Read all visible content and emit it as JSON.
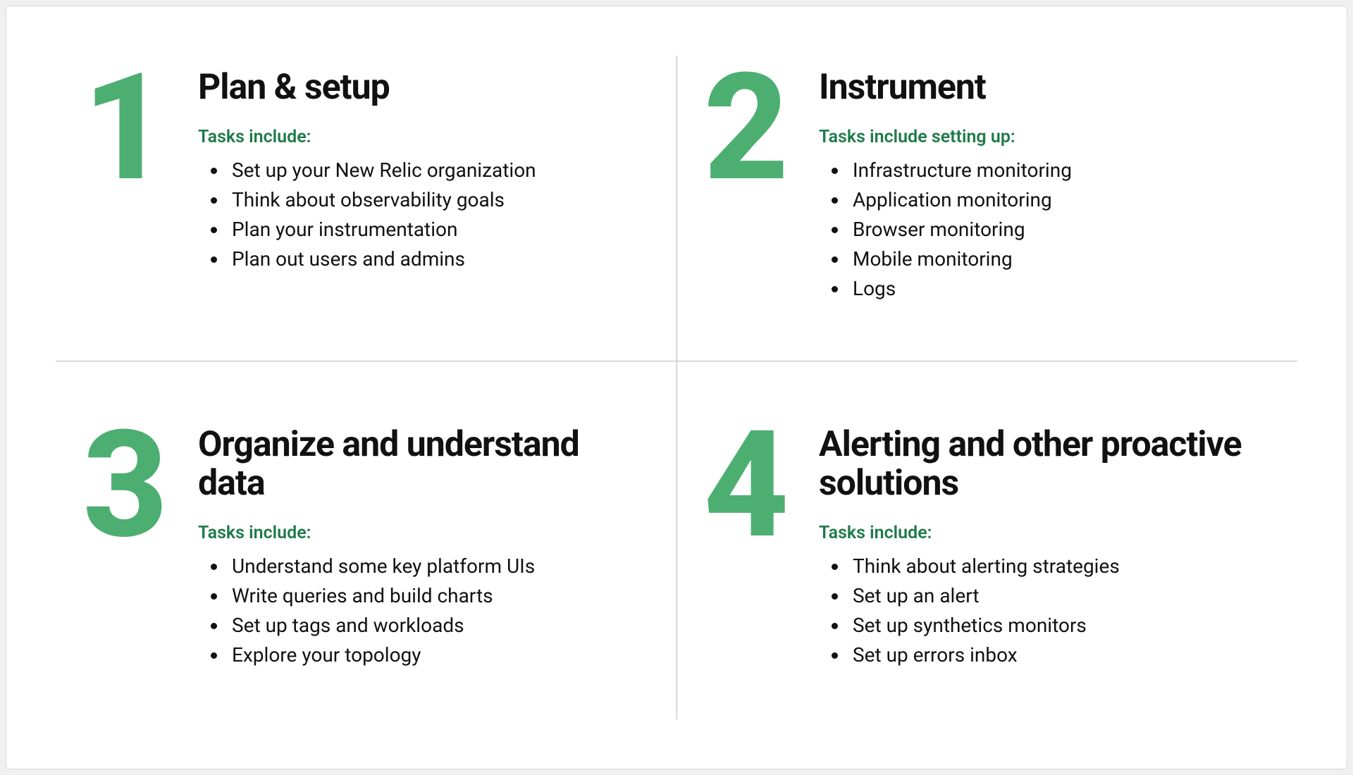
{
  "quadrants": [
    {
      "num": "1",
      "title": "Plan & setup",
      "tasks_label": "Tasks include:",
      "items": [
        "Set up your New Relic organization",
        "Think about observability goals",
        "Plan your instrumentation",
        "Plan out users and admins"
      ]
    },
    {
      "num": "2",
      "title": "Instrument",
      "tasks_label": "Tasks include setting up:",
      "items": [
        "Infrastructure monitoring",
        "Application monitoring",
        "Browser monitoring",
        "Mobile monitoring",
        "Logs"
      ]
    },
    {
      "num": "3",
      "title": "Organize and understand data",
      "tasks_label": "Tasks include:",
      "items": [
        "Understand some key platform UIs",
        "Write queries and build charts",
        "Set up tags and workloads",
        "Explore your topology"
      ]
    },
    {
      "num": "4",
      "title": "Alerting and other proactive solutions",
      "tasks_label": "Tasks include:",
      "items": [
        "Think about alerting strategies",
        "Set up an alert",
        "Set up synthetics monitors",
        "Set up errors inbox"
      ]
    }
  ]
}
